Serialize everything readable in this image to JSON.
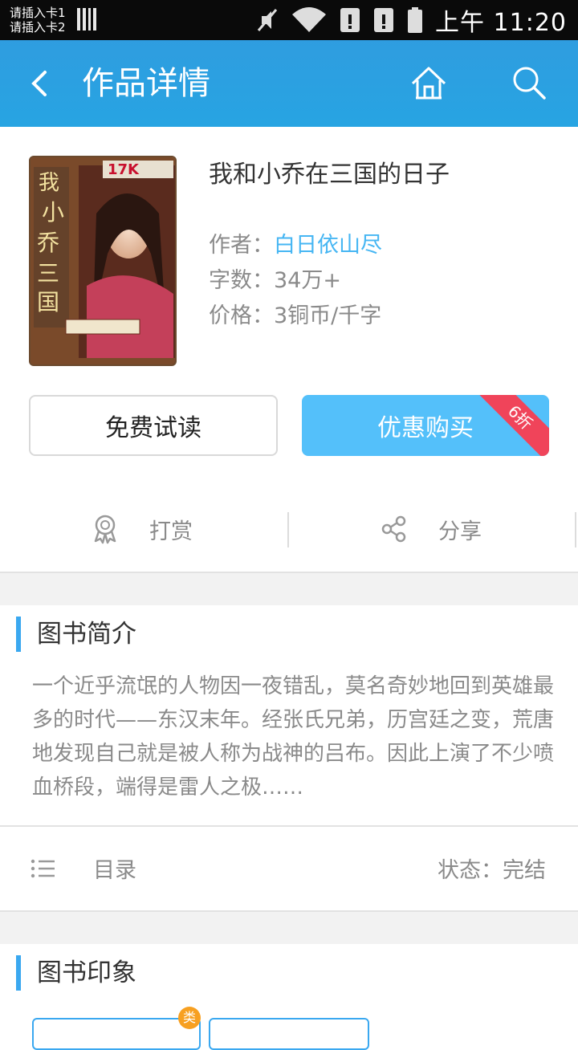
{
  "status_bar": {
    "sim1": "请插入卡1",
    "sim2": "请插入卡2",
    "time": "上午 11:20",
    "icons": [
      "mute-icon",
      "wifi-icon",
      "sim-alert-icon",
      "sim-alert-icon",
      "battery-icon"
    ]
  },
  "header": {
    "title": "作品详情",
    "back_icon": "back-arrow-icon",
    "home_icon": "home-icon",
    "search_icon": "search-icon"
  },
  "book": {
    "title": "我和小乔在三国的日子",
    "author_label": "作者：",
    "author": "白日依山尽",
    "words_label": "字数：",
    "words": "34万+",
    "price_label": "价格：",
    "price": "3铜币/千字",
    "cover_brand": "17K"
  },
  "buttons": {
    "free_read": "免费试读",
    "buy": "优惠购买",
    "discount": "6折"
  },
  "actions": {
    "reward": "打赏",
    "share": "分享"
  },
  "intro": {
    "heading": "图书简介",
    "text": "一个近乎流氓的人物因一夜错乱，莫名奇妙地回到英雄最多的时代——东汉末年。经张氏兄弟，历宫廷之变，荒唐地发现自己就是被人称为战神的吕布。因此上演了不少喷血桥段，端得是雷人之极……"
  },
  "toc": {
    "label": "目录",
    "status": "状态：完结"
  },
  "impression": {
    "heading": "图书印象",
    "badge": "类"
  },
  "colors": {
    "header": "#27a4e2",
    "accent": "#46b6f3",
    "buy_button": "#54c0fa",
    "ribbon": "#f0445a"
  }
}
